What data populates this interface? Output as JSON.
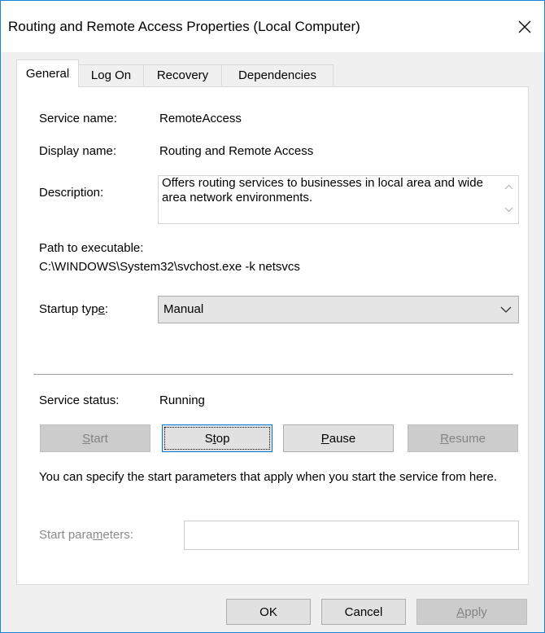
{
  "window": {
    "title": "Routing and Remote Access Properties (Local Computer)"
  },
  "tabs": [
    {
      "label": "General",
      "active": true
    },
    {
      "label": "Log On",
      "active": false
    },
    {
      "label": "Recovery",
      "active": false
    },
    {
      "label": "Dependencies",
      "active": false
    }
  ],
  "general": {
    "service_name_label": "Service name:",
    "service_name_value": "RemoteAccess",
    "display_name_label": "Display name:",
    "display_name_value": "Routing and Remote Access",
    "description_label": "Description:",
    "description_value": "Offers routing services to businesses in local area and wide area network environments.",
    "path_label": "Path to executable:",
    "path_value": "C:\\WINDOWS\\System32\\svchost.exe -k netsvcs",
    "startup_type_label_pre": "Startup typ",
    "startup_type_label_u": "e",
    "startup_type_label_post": ":",
    "startup_type_value": "Manual",
    "service_status_label": "Service status:",
    "service_status_value": "Running",
    "info_text": "You can specify the start parameters that apply when you start the service from here.",
    "start_params_label_pre": "Start para",
    "start_params_label_u": "m",
    "start_params_label_post": "eters:",
    "start_params_value": ""
  },
  "service_buttons": {
    "start": {
      "u": "S",
      "rest": "tart",
      "enabled": false
    },
    "stop": {
      "pre": "S",
      "u": "t",
      "rest": "op",
      "enabled": true
    },
    "pause": {
      "u": "P",
      "rest": "ause",
      "enabled": true
    },
    "resume": {
      "u": "R",
      "rest": "esume",
      "enabled": false
    }
  },
  "dialog_buttons": {
    "ok": "OK",
    "cancel": "Cancel",
    "apply_u": "A",
    "apply_rest": "pply"
  },
  "icons": {
    "close": "close-icon",
    "dropdown": "chevron-down-icon",
    "scroll_up": "scroll-up-icon",
    "scroll_down": "scroll-down-icon"
  },
  "colors": {
    "window_border": "#1883d7",
    "focus_border": "#0078d7",
    "dialog_bg": "#f0f0f0"
  }
}
